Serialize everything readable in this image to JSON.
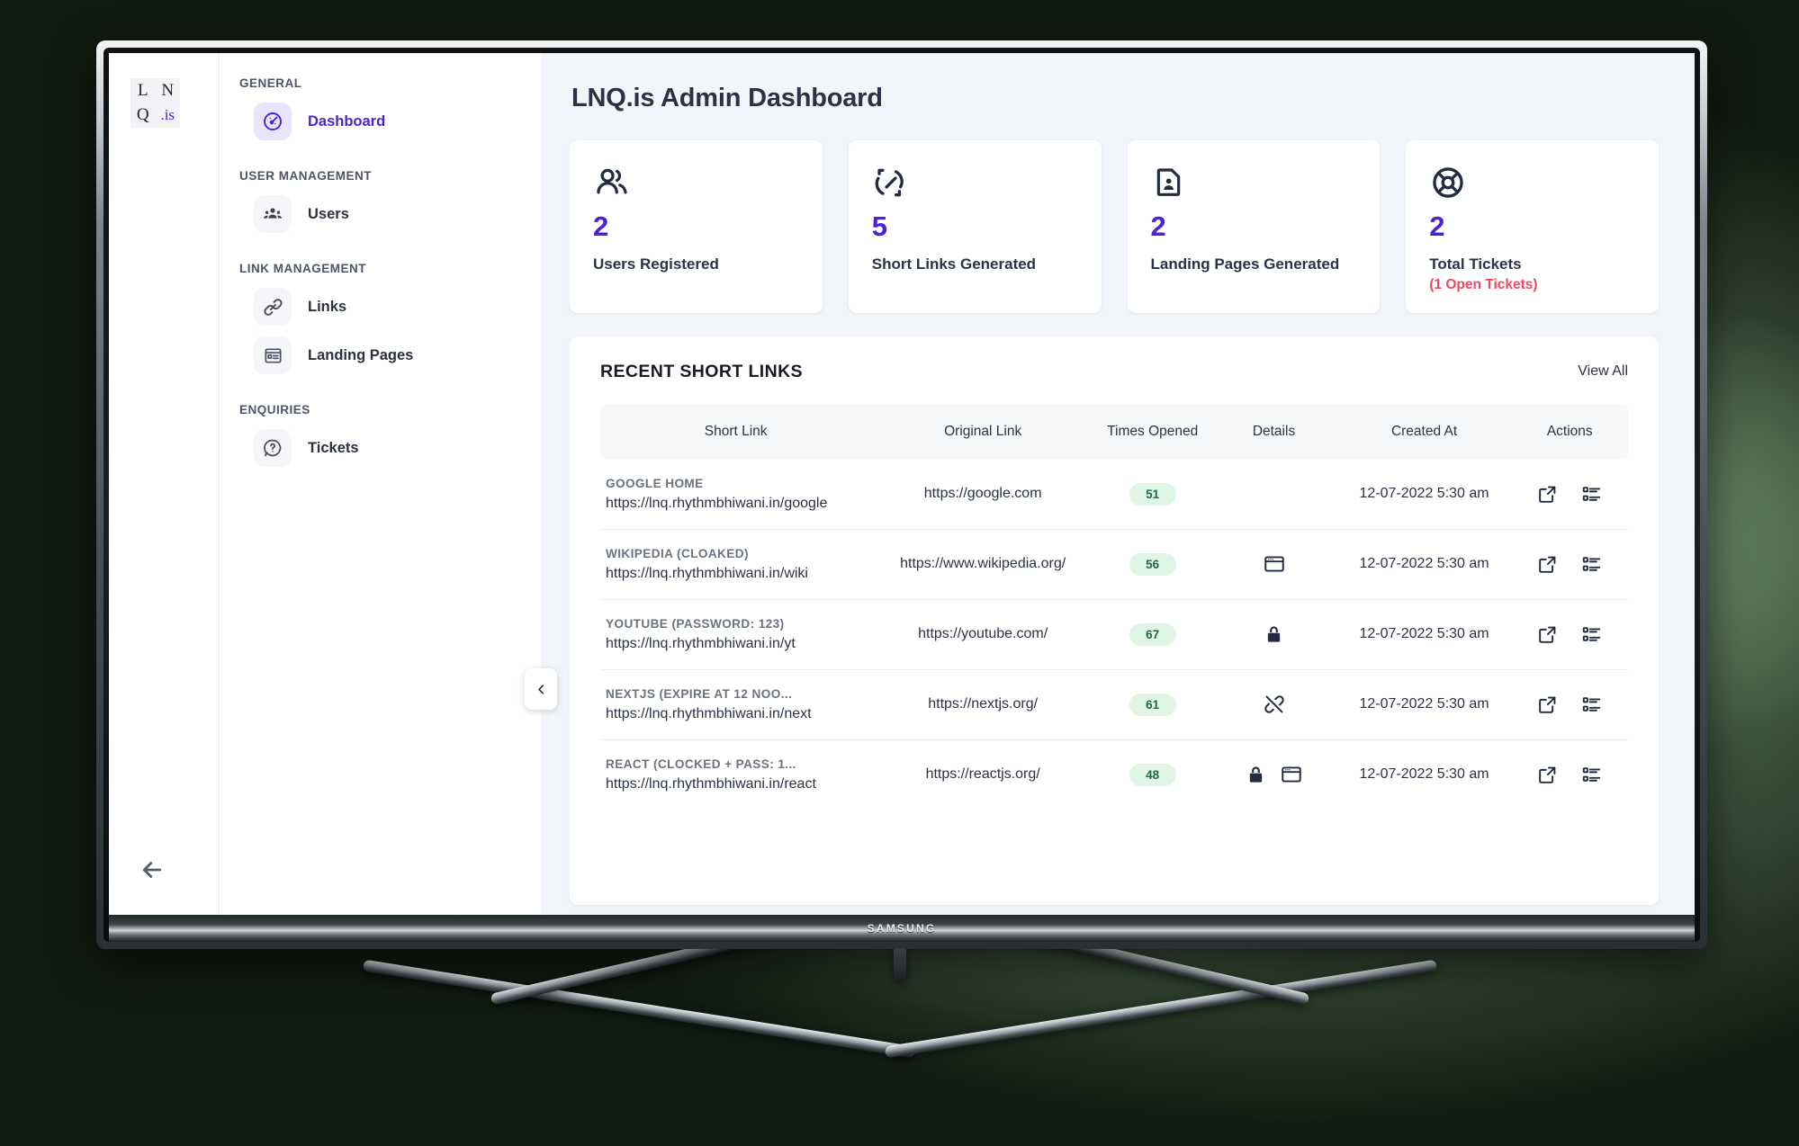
{
  "device": {
    "brand": "SAMSUNG"
  },
  "logo": {
    "l": "L",
    "n": "N",
    "q": "Q",
    "is": ".is"
  },
  "sidebar": {
    "groups": [
      {
        "title": "GENERAL",
        "items": [
          {
            "label": "Dashboard",
            "icon": "speedometer-icon",
            "active": true
          }
        ]
      },
      {
        "title": "USER MANAGEMENT",
        "items": [
          {
            "label": "Users",
            "icon": "users-group-icon",
            "active": false
          }
        ]
      },
      {
        "title": "LINK MANAGEMENT",
        "items": [
          {
            "label": "Links",
            "icon": "link-chain-icon",
            "active": false
          },
          {
            "label": "Landing Pages",
            "icon": "landing-page-icon",
            "active": false
          }
        ]
      },
      {
        "title": "ENQUIRIES",
        "items": [
          {
            "label": "Tickets",
            "icon": "question-bubble-icon",
            "active": false
          }
        ]
      }
    ],
    "back_icon": "arrow-left-icon",
    "collapse_icon": "chevron-left-icon"
  },
  "header": {
    "title": "LNQ.is Admin Dashboard"
  },
  "cards": [
    {
      "icon": "users-icon",
      "value": "2",
      "label": "Users Registered",
      "sub": ""
    },
    {
      "icon": "broken-link-icon",
      "value": "5",
      "label": "Short Links Generated",
      "sub": ""
    },
    {
      "icon": "document-person-icon",
      "value": "2",
      "label": "Landing Pages Generated",
      "sub": ""
    },
    {
      "icon": "lifebuoy-icon",
      "value": "2",
      "label": "Total Tickets",
      "sub": "(1 Open Tickets)"
    }
  ],
  "panel": {
    "title": "RECENT SHORT LINKS",
    "view_all": "View All",
    "columns": [
      "Short Link",
      "Original Link",
      "Times Opened",
      "Details",
      "Created At",
      "Actions"
    ],
    "rows": [
      {
        "name": "GOOGLE HOME",
        "short_url": "https://lnq.rhythmbhiwani.in/google",
        "original": "https://google.com",
        "times_opened": "51",
        "details": [],
        "created_at": "12-07-2022 5:30 am",
        "actions": [
          "open-external-icon",
          "details-list-icon"
        ]
      },
      {
        "name": "WIKIPEDIA (CLOAKED)",
        "short_url": "https://lnq.rhythmbhiwani.in/wiki",
        "original": "https://www.wikipedia.org/",
        "times_opened": "56",
        "details": [
          "cloaked-browser-icon"
        ],
        "created_at": "12-07-2022 5:30 am",
        "actions": [
          "open-external-icon",
          "details-list-icon"
        ]
      },
      {
        "name": "YOUTUBE (PASSWORD: 123)",
        "short_url": "https://lnq.rhythmbhiwani.in/yt",
        "original": "https://youtube.com/",
        "times_opened": "67",
        "details": [
          "lock-icon"
        ],
        "created_at": "12-07-2022 5:30 am",
        "actions": [
          "open-external-icon",
          "details-list-icon"
        ]
      },
      {
        "name": "NEXTJS (EXPIRE AT 12 NOO...",
        "short_url": "https://lnq.rhythmbhiwani.in/next",
        "original": "https://nextjs.org/",
        "times_opened": "61",
        "details": [
          "unlink-icon"
        ],
        "created_at": "12-07-2022 5:30 am",
        "actions": [
          "open-external-icon",
          "details-list-icon"
        ]
      },
      {
        "name": "REACT (CLOCKED + PASS: 1...",
        "short_url": "https://lnq.rhythmbhiwani.in/react",
        "original": "https://reactjs.org/",
        "times_opened": "48",
        "details": [
          "lock-icon",
          "cloaked-browser-icon"
        ],
        "created_at": "12-07-2022 5:30 am",
        "actions": [
          "open-external-icon",
          "details-list-icon"
        ]
      }
    ]
  },
  "colors": {
    "accent": "#4b22d6",
    "danger": "#f04860",
    "badge_bg": "#dff5e5",
    "badge_text": "#1f6b3f",
    "main_bg": "#f2f6fa",
    "text": "#2b3246"
  }
}
